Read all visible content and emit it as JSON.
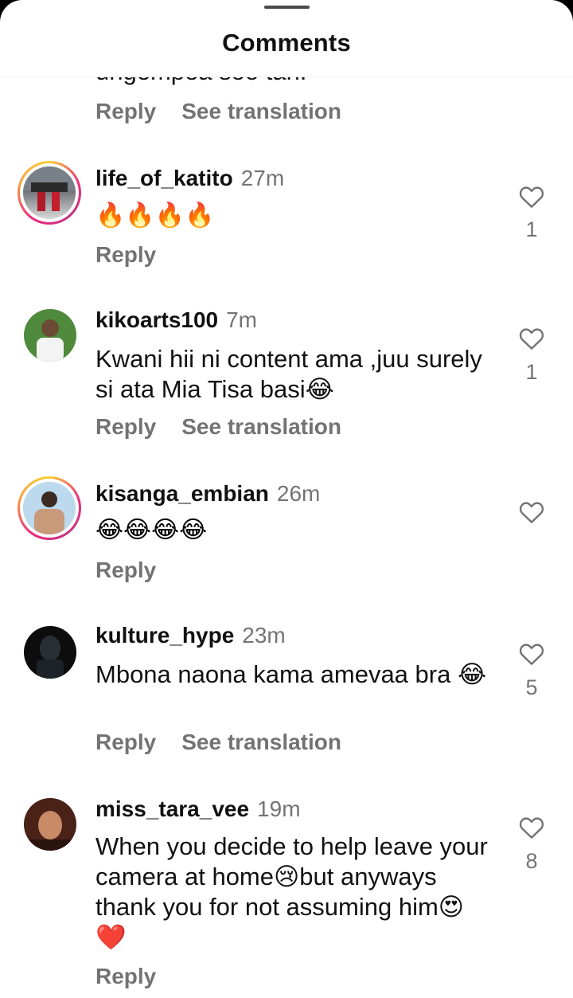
{
  "header": {
    "title": "Comments"
  },
  "partial_comment": {
    "text": "ungempea soo tan.",
    "reply_label": "Reply",
    "translate_label": "See translation"
  },
  "comments": [
    {
      "username": "life_of_katito",
      "time": "27m",
      "text": "🔥🔥🔥🔥",
      "likes": "1",
      "reply_label": "Reply",
      "translate_label": null,
      "story_ring": true
    },
    {
      "username": "kikoarts100",
      "time": "7m",
      "text": "Kwani hii ni content ama ,juu surely si ata Mia Tisa basi😂",
      "likes": "1",
      "reply_label": "Reply",
      "translate_label": "See translation",
      "story_ring": false
    },
    {
      "username": "kisanga_embian",
      "time": "26m",
      "text": "😂😂😂😂",
      "likes": "",
      "reply_label": "Reply",
      "translate_label": null,
      "story_ring": true
    },
    {
      "username": "kulture_hype",
      "time": "23m",
      "text": "Mbona naona kama amevaa bra 😂",
      "likes": "5",
      "reply_label": "Reply",
      "translate_label": "See translation",
      "story_ring": false
    },
    {
      "username": "miss_tara_vee",
      "time": "19m",
      "text": "When you decide to help leave your camera at home😢but anyways thank you for not assuming him😍❤️",
      "likes": "8",
      "reply_label": "Reply",
      "translate_label": null,
      "story_ring": false
    }
  ],
  "icons": {
    "like": "heart-outline-icon"
  },
  "colors": {
    "text": "#111111",
    "secondary": "#737373",
    "ring_start": "#f9ce34",
    "ring_end": "#ee2a7b"
  }
}
